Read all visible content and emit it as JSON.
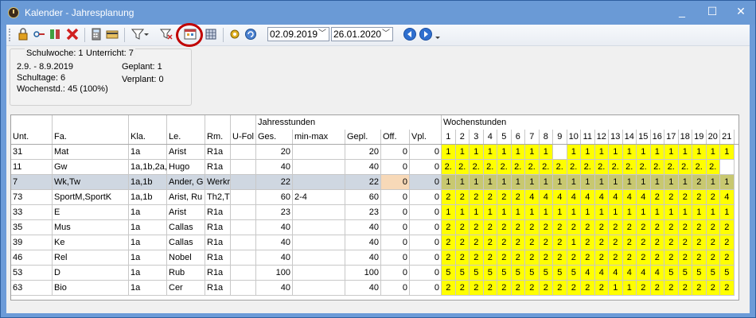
{
  "window": {
    "title": "Kalender - Jahresplanung",
    "minimize": "_",
    "maximize": "☐",
    "close": "✕"
  },
  "toolbar": {
    "date_from": "02.09.2019",
    "date_to": "26.01.2020"
  },
  "info": {
    "schulwoche": "Schulwoche: 1",
    "unterricht": "Unterricht: 7",
    "range": "2.9. - 8.9.2019",
    "schultage": "Schultage: 6",
    "wochenstd": "Wochenstd.: 45 (100%)",
    "geplant": "Geplant: 1",
    "verplant": "Verplant: 0"
  },
  "table": {
    "group_headers": {
      "jahresstunden": "Jahresstunden",
      "wochenstunden": "Wochenstunden"
    },
    "columns": [
      "Unt.",
      "Fa.",
      "Kla.",
      "Le.",
      "Rm.",
      "U-Fol",
      "Ges.",
      "min-max",
      "Gepl.",
      "Off.",
      "Vpl."
    ],
    "weeks": [
      "1",
      "2",
      "3",
      "4",
      "5",
      "6",
      "7",
      "8",
      "9",
      "10",
      "11",
      "12",
      "13",
      "14",
      "15",
      "16",
      "17",
      "18",
      "19",
      "20",
      "21"
    ],
    "rows": [
      {
        "unt": "31",
        "fa": "Mat",
        "kla": "1a",
        "le": "Arist",
        "rm": "R1a",
        "ufol": "",
        "ges": "20",
        "minmax": "",
        "gepl": "20",
        "off": "0",
        "vpl": "0",
        "w": [
          "1",
          "1",
          "1",
          "1",
          "1",
          "1",
          "1",
          "1",
          "",
          "1",
          "1",
          "1",
          "1",
          "1",
          "1",
          "1",
          "1",
          "1",
          "1",
          "1",
          "1"
        ]
      },
      {
        "unt": "11",
        "fa": "Gw",
        "kla": "1a,1b,2a,",
        "le": "Hugo",
        "rm": "R1a",
        "ufol": "",
        "ges": "40",
        "minmax": "",
        "gepl": "40",
        "off": "0",
        "vpl": "0",
        "w": [
          "2.",
          "2.",
          "2.",
          "2.",
          "2.",
          "2.",
          "2.",
          "2.",
          "2.",
          "2.",
          "2.",
          "2.",
          "2.",
          "2.",
          "2.",
          "2.",
          "2.",
          "2.",
          "2.",
          "2.",
          ""
        ]
      },
      {
        "unt": "7",
        "fa": "Wk,Tw",
        "kla": "1a,1b",
        "le": "Ander, G",
        "rm": "Werkr",
        "ufol": "",
        "ges": "22",
        "minmax": "",
        "gepl": "22",
        "off": "0",
        "vpl": "0",
        "selected": true,
        "w": [
          "1",
          "1",
          "1",
          "1",
          "1",
          "1",
          "1",
          "1",
          "1",
          "1",
          "1",
          "1",
          "1",
          "1",
          "1",
          "1",
          "1",
          "1",
          "2",
          "1",
          "1"
        ]
      },
      {
        "unt": "73",
        "fa": "SportM,SportK",
        "kla": "1a,1b",
        "le": "Arist, Ru",
        "rm": "Th2,T",
        "ufol": "",
        "ges": "60",
        "minmax": "2-4",
        "gepl": "60",
        "off": "0",
        "vpl": "0",
        "w": [
          "2",
          "2",
          "2",
          "2",
          "2",
          "2",
          "4",
          "4",
          "4",
          "4",
          "4",
          "4",
          "4",
          "4",
          "4",
          "2",
          "2",
          "2",
          "2",
          "2",
          "4"
        ]
      },
      {
        "unt": "33",
        "fa": "E",
        "kla": "1a",
        "le": "Arist",
        "rm": "R1a",
        "ufol": "",
        "ges": "23",
        "minmax": "",
        "gepl": "23",
        "off": "0",
        "vpl": "0",
        "w": [
          "1",
          "1",
          "1",
          "1",
          "1",
          "1",
          "1",
          "1",
          "1",
          "1",
          "1",
          "1",
          "1",
          "1",
          "1",
          "1",
          "1",
          "1",
          "1",
          "1",
          "1"
        ]
      },
      {
        "unt": "35",
        "fa": "Mus",
        "kla": "1a",
        "le": "Callas",
        "rm": "R1a",
        "ufol": "",
        "ges": "40",
        "minmax": "",
        "gepl": "40",
        "off": "0",
        "vpl": "0",
        "w": [
          "2",
          "2",
          "2",
          "2",
          "2",
          "2",
          "2",
          "2",
          "2",
          "2",
          "2",
          "2",
          "2",
          "2",
          "2",
          "2",
          "2",
          "2",
          "2",
          "2",
          "2"
        ]
      },
      {
        "unt": "39",
        "fa": "Ke",
        "kla": "1a",
        "le": "Callas",
        "rm": "R1a",
        "ufol": "",
        "ges": "40",
        "minmax": "",
        "gepl": "40",
        "off": "0",
        "vpl": "0",
        "w": [
          "2",
          "2",
          "2",
          "2",
          "2",
          "2",
          "2",
          "2",
          "2",
          "1",
          "2",
          "2",
          "2",
          "2",
          "2",
          "2",
          "2",
          "2",
          "2",
          "2",
          "2"
        ]
      },
      {
        "unt": "46",
        "fa": "Rel",
        "kla": "1a",
        "le": "Nobel",
        "rm": "R1a",
        "ufol": "",
        "ges": "40",
        "minmax": "",
        "gepl": "40",
        "off": "0",
        "vpl": "0",
        "w": [
          "2",
          "2",
          "2",
          "2",
          "2",
          "2",
          "2",
          "2",
          "2",
          "2",
          "2",
          "2",
          "2",
          "2",
          "2",
          "2",
          "2",
          "2",
          "2",
          "2",
          "2"
        ]
      },
      {
        "unt": "53",
        "fa": "D",
        "kla": "1a",
        "le": "Rub",
        "rm": "R1a",
        "ufol": "",
        "ges": "100",
        "minmax": "",
        "gepl": "100",
        "off": "0",
        "vpl": "0",
        "w": [
          "5",
          "5",
          "5",
          "5",
          "5",
          "5",
          "5",
          "5",
          "5",
          "5",
          "4",
          "4",
          "4",
          "4",
          "4",
          "4",
          "5",
          "5",
          "5",
          "5",
          "5"
        ]
      },
      {
        "unt": "63",
        "fa": "Bio",
        "kla": "1a",
        "le": "Cer",
        "rm": "R1a",
        "ufol": "",
        "ges": "40",
        "minmax": "",
        "gepl": "40",
        "off": "0",
        "vpl": "0",
        "w": [
          "2",
          "2",
          "2",
          "2",
          "2",
          "2",
          "2",
          "2",
          "2",
          "2",
          "2",
          "2",
          "1",
          "1",
          "2",
          "2",
          "2",
          "2",
          "2",
          "2",
          "2"
        ]
      }
    ]
  }
}
